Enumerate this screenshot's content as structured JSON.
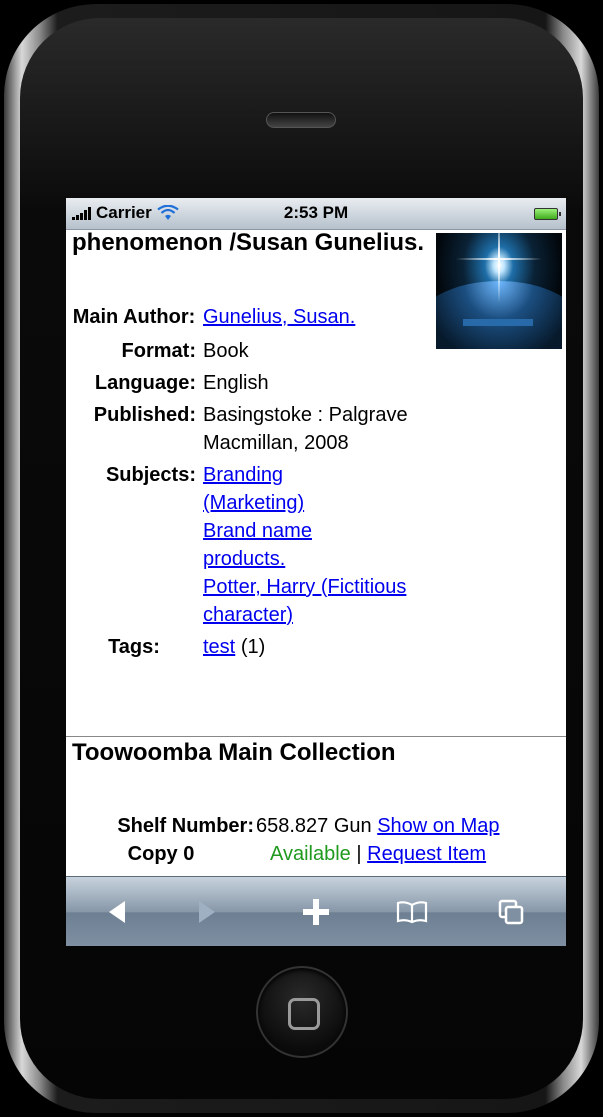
{
  "status_bar": {
    "carrier": "Carrier",
    "time": "2:53 PM"
  },
  "record": {
    "title": "phenomenon /Susan Gunelius.",
    "cover_icon": "book-cover-image",
    "fields": {
      "main_author_label": "Main Author:",
      "main_author_value": "Gunelius, Susan.",
      "format_label": "Format:",
      "format_value": "Book",
      "language_label": "Language:",
      "language_value": "English",
      "published_label": "Published:",
      "published_value": "Basingstoke : Palgrave Macmillan, 2008",
      "subjects_label": "Subjects:",
      "subjects": [
        "Branding (Marketing)",
        "Brand name products.",
        "Potter, Harry (Fictitious character)"
      ],
      "tags_label": "Tags:",
      "tag_link": "test",
      "tag_count": "(1)"
    }
  },
  "holdings": {
    "collection_title": "Toowoomba Main Collection",
    "shelf_label": "Shelf Number:",
    "shelf_value": "658.827 Gun",
    "map_link": "Show on Map",
    "copy_label": "Copy 0",
    "availability": "Available",
    "separator": "|",
    "request_link": "Request Item"
  },
  "toolbar": {
    "icons": [
      "back-icon",
      "forward-icon",
      "add-icon",
      "bookmarks-icon",
      "pages-icon"
    ]
  },
  "colors": {
    "link": "#0000ee",
    "available": "#1f9a1f",
    "toolbar": "#8797a8"
  }
}
